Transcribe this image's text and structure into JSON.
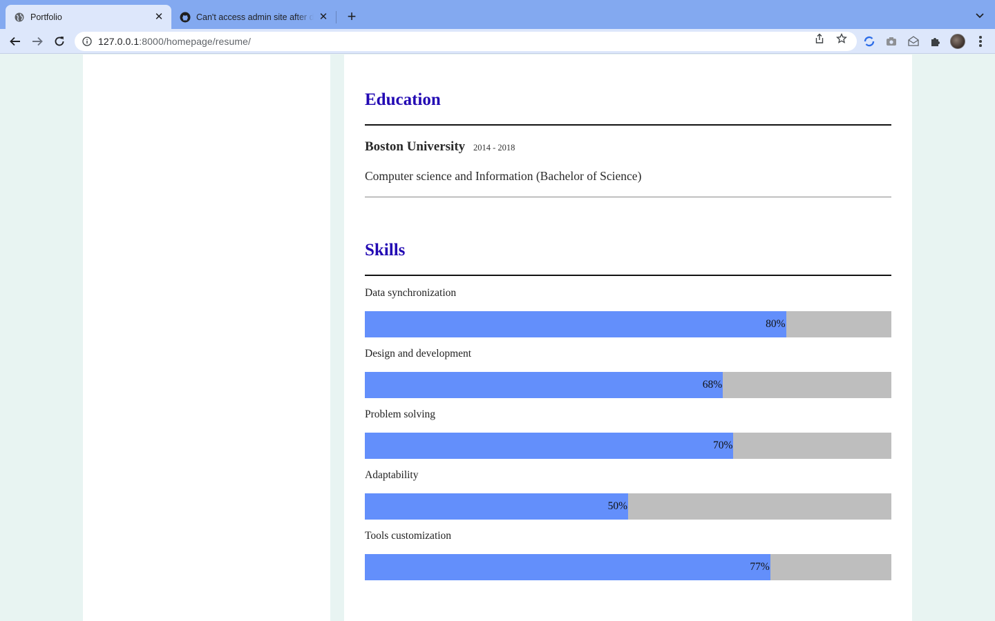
{
  "browser": {
    "tabs": [
      {
        "title": "Portfolio",
        "active": true
      },
      {
        "title": "Can't access admin site after d",
        "active": false
      }
    ],
    "url_host": "127.0.0.1",
    "url_rest": ":8000/homepage/resume/"
  },
  "education": {
    "heading": "Education",
    "school": "Boston University",
    "years": "2014 - 2018",
    "degree": "Computer science and Information (Bachelor of Science)"
  },
  "skills": {
    "heading": "Skills",
    "items": [
      {
        "label": "Data synchronization",
        "percent_text": "80%",
        "level": 80
      },
      {
        "label": "Design and development",
        "percent_text": "68%",
        "level": 68
      },
      {
        "label": "Problem solving",
        "percent_text": "70%",
        "level": 70
      },
      {
        "label": "Adaptability",
        "percent_text": "50%",
        "level": 50
      },
      {
        "label": "Tools customization",
        "percent_text": "77%",
        "level": 77
      }
    ]
  },
  "colors": {
    "heading": "#2208b3",
    "bar_fill": "#638ffb",
    "bar_track": "#bebebe",
    "tabbar": "#83a9f0",
    "page_bg": "#e8f4f2"
  }
}
